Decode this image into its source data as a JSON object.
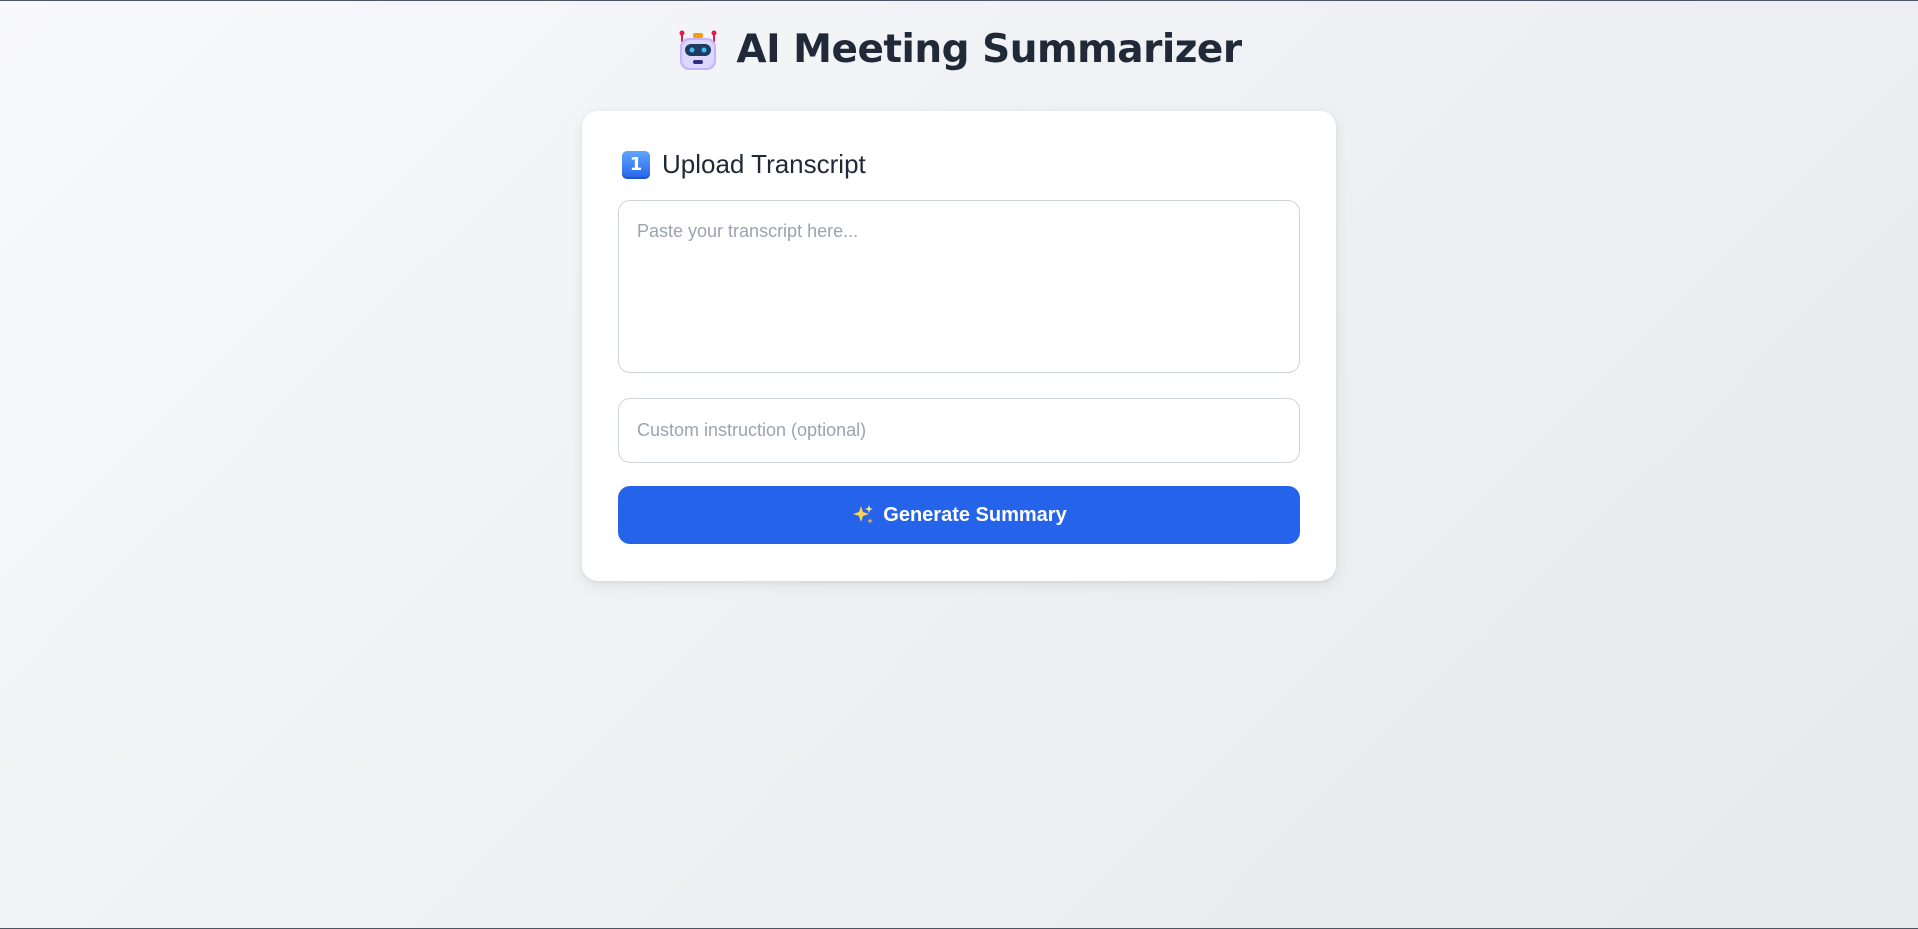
{
  "header": {
    "title": "AI Meeting Summarizer",
    "icon": "robot-icon"
  },
  "upload": {
    "step_icon": "keycap-1-icon",
    "step_number": "1",
    "heading": "Upload Transcript",
    "transcript_placeholder": "Paste your transcript here...",
    "transcript_value": "",
    "instruction_placeholder": "Custom instruction (optional)",
    "instruction_value": "",
    "generate_icon": "sparkles-icon",
    "generate_label": "Generate Summary"
  },
  "colors": {
    "accent": "#2563eb",
    "title_text": "#1f2937",
    "card_background": "#ffffff",
    "placeholder": "#9ca3af"
  }
}
